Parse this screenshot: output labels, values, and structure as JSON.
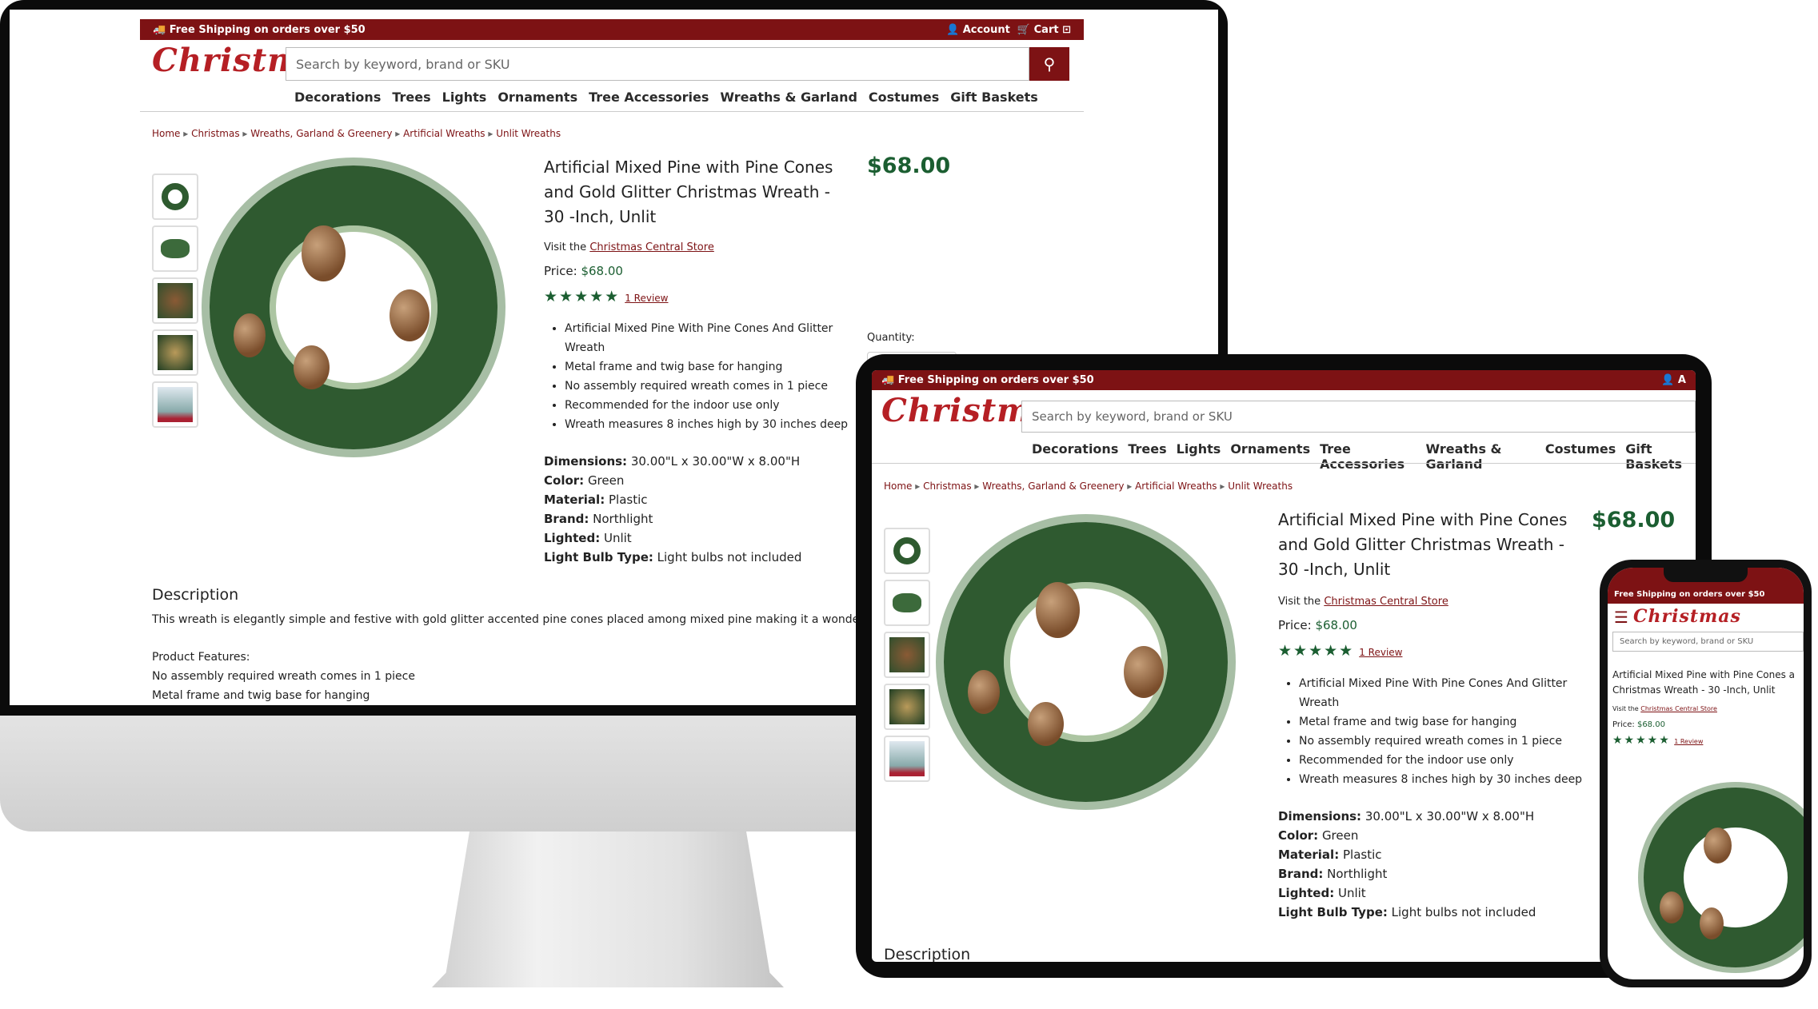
{
  "topbar": {
    "shipping": "Free Shipping on orders over $50",
    "account": "Account",
    "cart": "Cart"
  },
  "brand": {
    "logo_text": "Christmas"
  },
  "search": {
    "placeholder": "Search by keyword, brand or SKU"
  },
  "nav": [
    "Decorations",
    "Trees",
    "Lights",
    "Ornaments",
    "Tree Accessories",
    "Wreaths & Garland",
    "Costumes",
    "Gift Baskets"
  ],
  "breadcrumbs": [
    "Home",
    "Christmas",
    "Wreaths, Garland & Greenery",
    "Artificial Wreaths",
    "Unlit Wreaths"
  ],
  "product": {
    "title": "Artificial Mixed Pine with Pine Cones and Gold Glitter Christmas Wreath - 30 -Inch, Unlit",
    "title_lines": [
      "Artificial Mixed Pine with Pine Cones",
      "and Gold Glitter Christmas Wreath -",
      "30 -Inch, Unlit"
    ],
    "phone_title_lines": [
      "Artificial Mixed Pine with Pine Cones a",
      "Christmas Wreath - 30 -Inch, Unlit"
    ],
    "price": "$68.00",
    "visit_prefix": "Visit the",
    "store": "Christmas Central Store",
    "price_label": "Price:",
    "rating": 5,
    "reviews": "1 Review",
    "quantity_label": "Quantity:",
    "bullets": [
      "Artificial Mixed Pine With Pine Cones And Glitter Wreath",
      "Metal frame and twig base for hanging",
      "No assembly required wreath comes in 1 piece",
      "Recommended for the indoor use only",
      "Wreath measures 8 inches high by 30 inches deep"
    ],
    "specs": [
      {
        "label": "Dimensions:",
        "value": "30.00\"L x 30.00\"W x 8.00\"H"
      },
      {
        "label": "Color:",
        "value": "Green"
      },
      {
        "label": "Material:",
        "value": "Plastic"
      },
      {
        "label": "Brand:",
        "value": "Northlight"
      },
      {
        "label": "Lighted:",
        "value": "Unlit"
      },
      {
        "label": "Light Bulb Type:",
        "value": "Light bulbs not included"
      }
    ],
    "description_heading": "Description",
    "description_text": "This wreath is elegantly simple and festive with gold glitter accented pine cones placed among mixed pine making it a wonderful addi",
    "features_heading": "Product Features:",
    "features": [
      "No assembly required wreath comes in 1 piece",
      "Metal frame and twig base for hanging"
    ]
  },
  "colors": {
    "brand_red": "#7d1214",
    "logo_red": "#b51f24",
    "price_green": "#1b5e31"
  }
}
